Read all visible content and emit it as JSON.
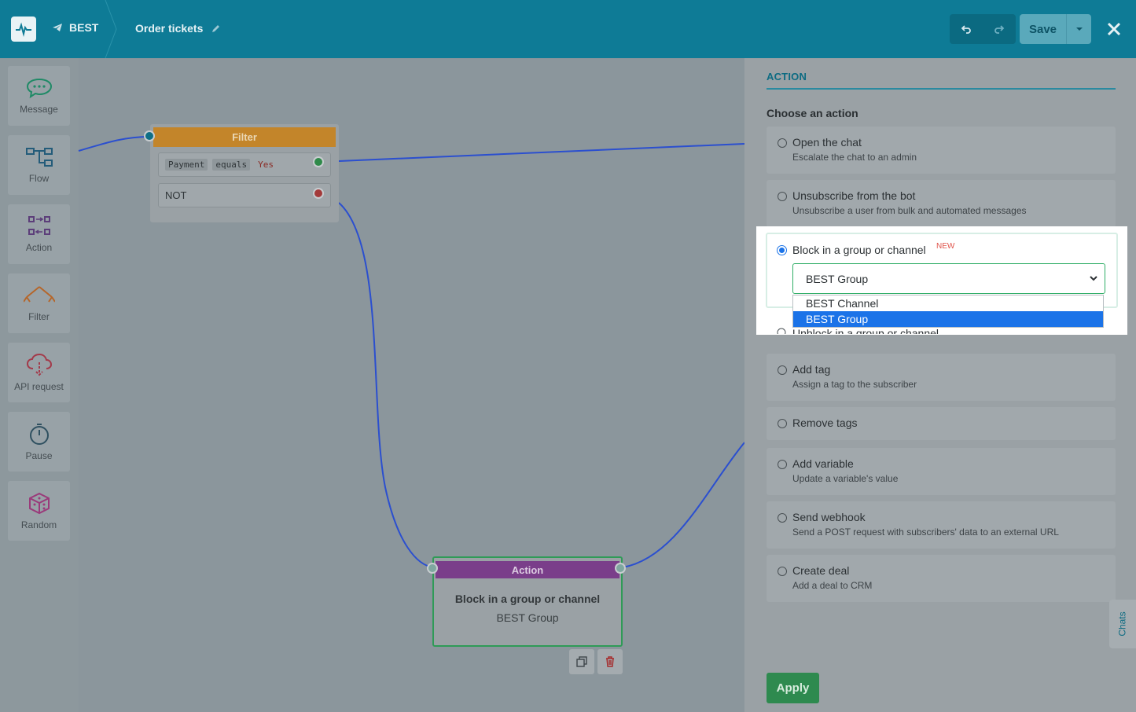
{
  "topbar": {
    "bot_name": "BEST",
    "flow_name": "Order tickets",
    "save_label": "Save"
  },
  "toolbar": {
    "items": [
      {
        "label": "Message"
      },
      {
        "label": "Flow"
      },
      {
        "label": "Action"
      },
      {
        "label": "Filter"
      },
      {
        "label": "API request"
      },
      {
        "label": "Pause"
      },
      {
        "label": "Random"
      }
    ]
  },
  "canvas": {
    "filter_node": {
      "title": "Filter",
      "condition": {
        "field": "Payment",
        "operator": "equals",
        "value": "Yes"
      },
      "else_label": "NOT"
    },
    "action_node": {
      "title": "Action",
      "action": "Block in a group or channel",
      "target": "BEST Group"
    }
  },
  "panel": {
    "section_title": "ACTION",
    "choose_label": "Choose an action",
    "options": [
      {
        "title": "Open the chat",
        "desc": "Escalate the chat to an admin"
      },
      {
        "title": "Unsubscribe from the bot",
        "desc": "Unsubscribe a user from bulk and automated messages"
      },
      {
        "title": "Block in a group or channel",
        "badge": "NEW",
        "selected": true
      },
      {
        "title": "Unblock in a group or channel"
      },
      {
        "title": "Add tag",
        "desc": "Assign a tag to the subscriber"
      },
      {
        "title": "Remove tags"
      },
      {
        "title": "Add variable",
        "desc": "Update a variable's value"
      },
      {
        "title": "Send webhook",
        "desc": "Send a POST request with subscribers' data to an external URL"
      },
      {
        "title": "Create deal",
        "desc": "Add a deal to CRM"
      }
    ],
    "select": {
      "value": "BEST Group",
      "options": [
        "BEST Channel",
        "BEST Group"
      ]
    },
    "apply_label": "Apply",
    "chats_label": "Chats"
  },
  "colors": {
    "brand": "#0e7b96",
    "filter": "#c3852a",
    "action": "#7a3e8a",
    "apply": "#2e8a4f",
    "selection": "#1b73e8"
  }
}
